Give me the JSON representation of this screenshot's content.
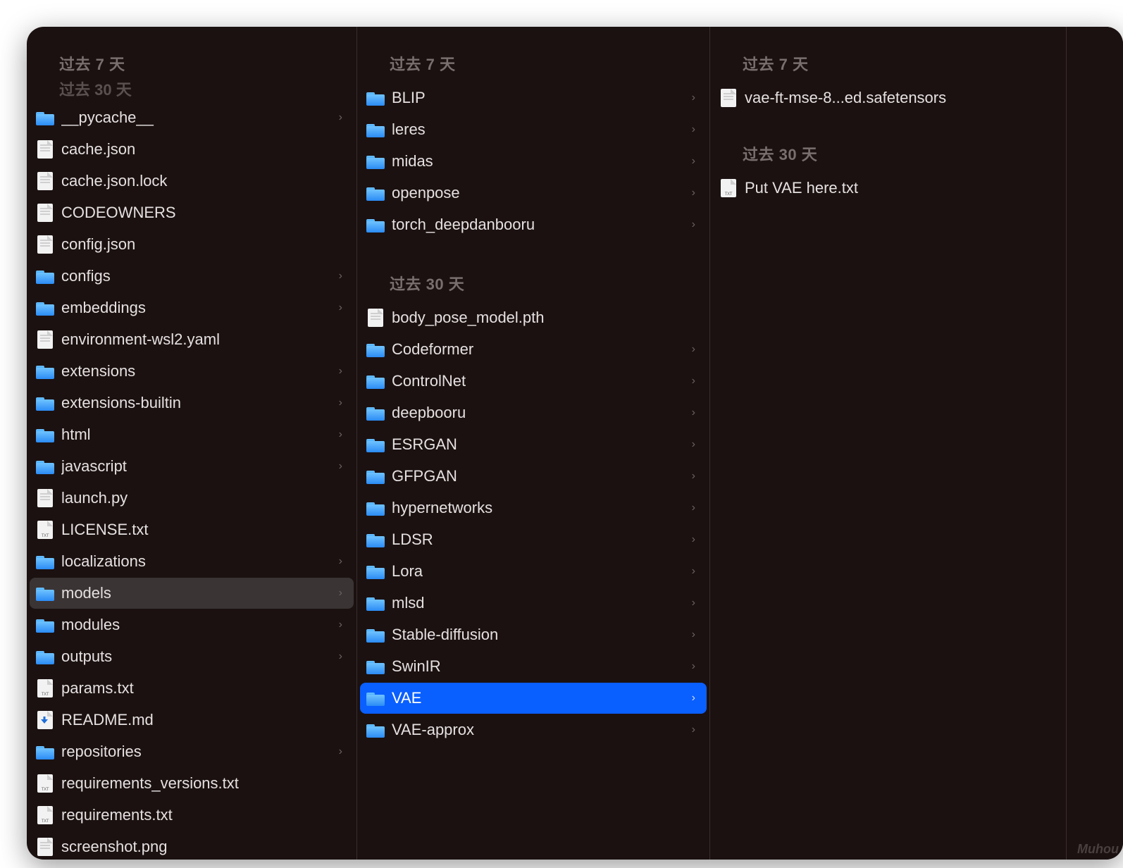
{
  "labels": {
    "past7": "过去 7 天",
    "past30": "过去 30 天"
  },
  "col1_clipped_header": "过去 30 天",
  "col1": [
    {
      "name": "__pycache__",
      "type": "folder",
      "arrow": true
    },
    {
      "name": "cache.json",
      "type": "file",
      "ftype": "json"
    },
    {
      "name": "cache.json.lock",
      "type": "file",
      "ftype": "generic"
    },
    {
      "name": "CODEOWNERS",
      "type": "file",
      "ftype": "generic"
    },
    {
      "name": "config.json",
      "type": "file",
      "ftype": "generic"
    },
    {
      "name": "configs",
      "type": "folder",
      "arrow": true
    },
    {
      "name": "embeddings",
      "type": "folder",
      "arrow": true
    },
    {
      "name": "environment-wsl2.yaml",
      "type": "file",
      "ftype": "yaml"
    },
    {
      "name": "extensions",
      "type": "folder",
      "arrow": true
    },
    {
      "name": "extensions-builtin",
      "type": "folder",
      "arrow": true
    },
    {
      "name": "html",
      "type": "folder",
      "arrow": true
    },
    {
      "name": "javascript",
      "type": "folder",
      "arrow": true
    },
    {
      "name": "launch.py",
      "type": "file",
      "ftype": "py"
    },
    {
      "name": "LICENSE.txt",
      "type": "file",
      "ftype": "txt"
    },
    {
      "name": "localizations",
      "type": "folder",
      "arrow": true
    },
    {
      "name": "models",
      "type": "folder",
      "arrow": true,
      "active": "grey"
    },
    {
      "name": "modules",
      "type": "folder",
      "arrow": true
    },
    {
      "name": "outputs",
      "type": "folder",
      "arrow": true
    },
    {
      "name": "params.txt",
      "type": "file",
      "ftype": "txt"
    },
    {
      "name": "README.md",
      "type": "file",
      "ftype": "md"
    },
    {
      "name": "repositories",
      "type": "folder",
      "arrow": true
    },
    {
      "name": "requirements_versions.txt",
      "type": "file",
      "ftype": "txt"
    },
    {
      "name": "requirements.txt",
      "type": "file",
      "ftype": "txt"
    },
    {
      "name": "screenshot.png",
      "type": "file",
      "ftype": "generic"
    }
  ],
  "col2_a": [
    {
      "name": "BLIP",
      "type": "folder",
      "arrow": true
    },
    {
      "name": "leres",
      "type": "folder",
      "arrow": true
    },
    {
      "name": "midas",
      "type": "folder",
      "arrow": true
    },
    {
      "name": "openpose",
      "type": "folder",
      "arrow": true
    },
    {
      "name": "torch_deepdanbooru",
      "type": "folder",
      "arrow": true
    }
  ],
  "col2_b": [
    {
      "name": "body_pose_model.pth",
      "type": "file",
      "ftype": "generic"
    },
    {
      "name": "Codeformer",
      "type": "folder",
      "arrow": true
    },
    {
      "name": "ControlNet",
      "type": "folder",
      "arrow": true
    },
    {
      "name": "deepbooru",
      "type": "folder",
      "arrow": true
    },
    {
      "name": "ESRGAN",
      "type": "folder",
      "arrow": true
    },
    {
      "name": "GFPGAN",
      "type": "folder",
      "arrow": true
    },
    {
      "name": "hypernetworks",
      "type": "folder",
      "arrow": true
    },
    {
      "name": "LDSR",
      "type": "folder",
      "arrow": true
    },
    {
      "name": "Lora",
      "type": "folder",
      "arrow": true
    },
    {
      "name": "mlsd",
      "type": "folder",
      "arrow": true
    },
    {
      "name": "Stable-diffusion",
      "type": "folder",
      "arrow": true
    },
    {
      "name": "SwinIR",
      "type": "folder",
      "arrow": true
    },
    {
      "name": "VAE",
      "type": "folder",
      "arrow": true,
      "active": "blue"
    },
    {
      "name": "VAE-approx",
      "type": "folder",
      "arrow": true
    }
  ],
  "col3_a": [
    {
      "name": "vae-ft-mse-8...ed.safetensors",
      "type": "file",
      "ftype": "generic"
    }
  ],
  "col3_b": [
    {
      "name": "Put VAE here.txt",
      "type": "file",
      "ftype": "txt"
    }
  ],
  "watermark": "Muhou"
}
